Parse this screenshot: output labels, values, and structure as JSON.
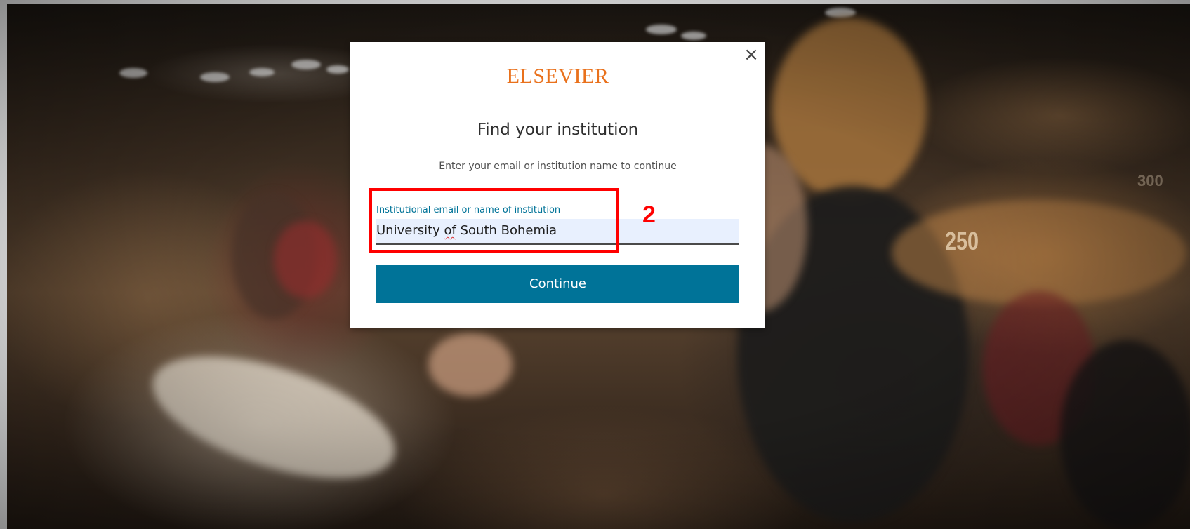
{
  "modal": {
    "brand": "ELSEVIER",
    "title": "Find your institution",
    "subtitle": "Enter your email or institution name to continue",
    "close_glyph": "×",
    "field": {
      "label": "Institutional email or name of institution",
      "value_before": "University ",
      "value_misspelled": "of",
      "value_after": " South Bohemia"
    },
    "continue_label": "Continue"
  },
  "annotation": {
    "step_number": "2",
    "color": "#ff0000"
  },
  "colors": {
    "brand": "#e9711c",
    "field_label": "#007398",
    "button_bg": "#007398",
    "field_bg": "#e8f0fe"
  },
  "icons": {
    "close": "close-icon"
  }
}
